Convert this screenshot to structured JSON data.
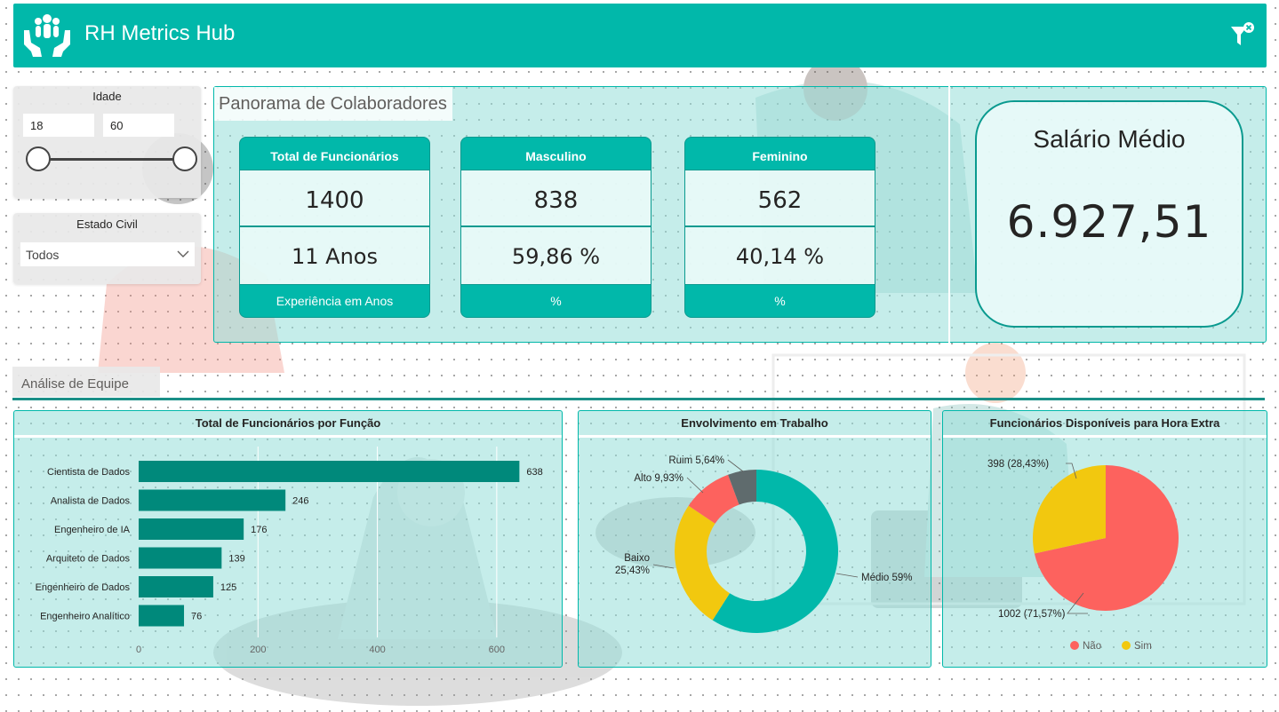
{
  "app": {
    "title": "RH Metrics Hub"
  },
  "colors": {
    "brand": "#01b8aa",
    "bar": "#00897b",
    "medio": "#01b8aa",
    "baixo": "#f2c80f",
    "alto": "#fd625e",
    "ruim": "#5f6b6d",
    "nao": "#fd625e",
    "sim": "#f2c80f"
  },
  "icons": {
    "logo": "people-hands-icon",
    "filter": "clear-filter-icon",
    "dropdown": "chevron-down-icon"
  },
  "slicers": {
    "age": {
      "title": "Idade",
      "min": "18",
      "max": "60"
    },
    "civil": {
      "title": "Estado Civil",
      "value": "Todos"
    }
  },
  "panorama": {
    "title": "Panorama de Colaboradores",
    "cards": {
      "total": {
        "header": "Total de Funcionários",
        "value": "1400",
        "secondary": "11 Anos",
        "footer": "Experiência em Anos"
      },
      "male": {
        "header": "Masculino",
        "value": "838",
        "secondary": "59,86 %",
        "footer": "%"
      },
      "female": {
        "header": "Feminino",
        "value": "562",
        "secondary": "40,14 %",
        "footer": "%"
      }
    },
    "salary": {
      "title": "Salário Médio",
      "value": "6.927,51"
    }
  },
  "team": {
    "label": "Análise de Equipe"
  },
  "chart_data": [
    {
      "type": "bar",
      "orientation": "horizontal",
      "title": "Total de Funcionários por Função",
      "categories": [
        "Cientista de Dados",
        "Analista de Dados",
        "Engenheiro de IA",
        "Arquiteto de Dados",
        "Engenheiro de Dados",
        "Engenheiro Analítico"
      ],
      "values": [
        638,
        246,
        176,
        139,
        125,
        76
      ],
      "x_ticks": [
        0,
        200,
        400,
        600
      ],
      "xlim": [
        0,
        700
      ],
      "grid": true
    },
    {
      "type": "pie",
      "variant": "donut",
      "title": "Envolvimento em Trabalho",
      "slices": [
        {
          "label": "Médio 59%",
          "value": 59.0,
          "color": "#01b8aa"
        },
        {
          "label": "Baixo 25,43%",
          "value": 25.43,
          "color": "#f2c80f"
        },
        {
          "label": "Alto 9,93%",
          "value": 9.93,
          "color": "#fd625e"
        },
        {
          "label": "Ruim 5,64%",
          "value": 5.64,
          "color": "#5f6b6d"
        }
      ]
    },
    {
      "type": "pie",
      "title": "Funcionários Disponíveis para Hora Extra",
      "slices": [
        {
          "name": "Não",
          "label": "1002 (71,57%)",
          "value": 1002,
          "color": "#fd625e"
        },
        {
          "name": "Sim",
          "label": "398 (28,43%)",
          "value": 398,
          "color": "#f2c80f"
        }
      ],
      "legend": [
        "Não",
        "Sim"
      ],
      "legend_position": "bottom"
    }
  ]
}
